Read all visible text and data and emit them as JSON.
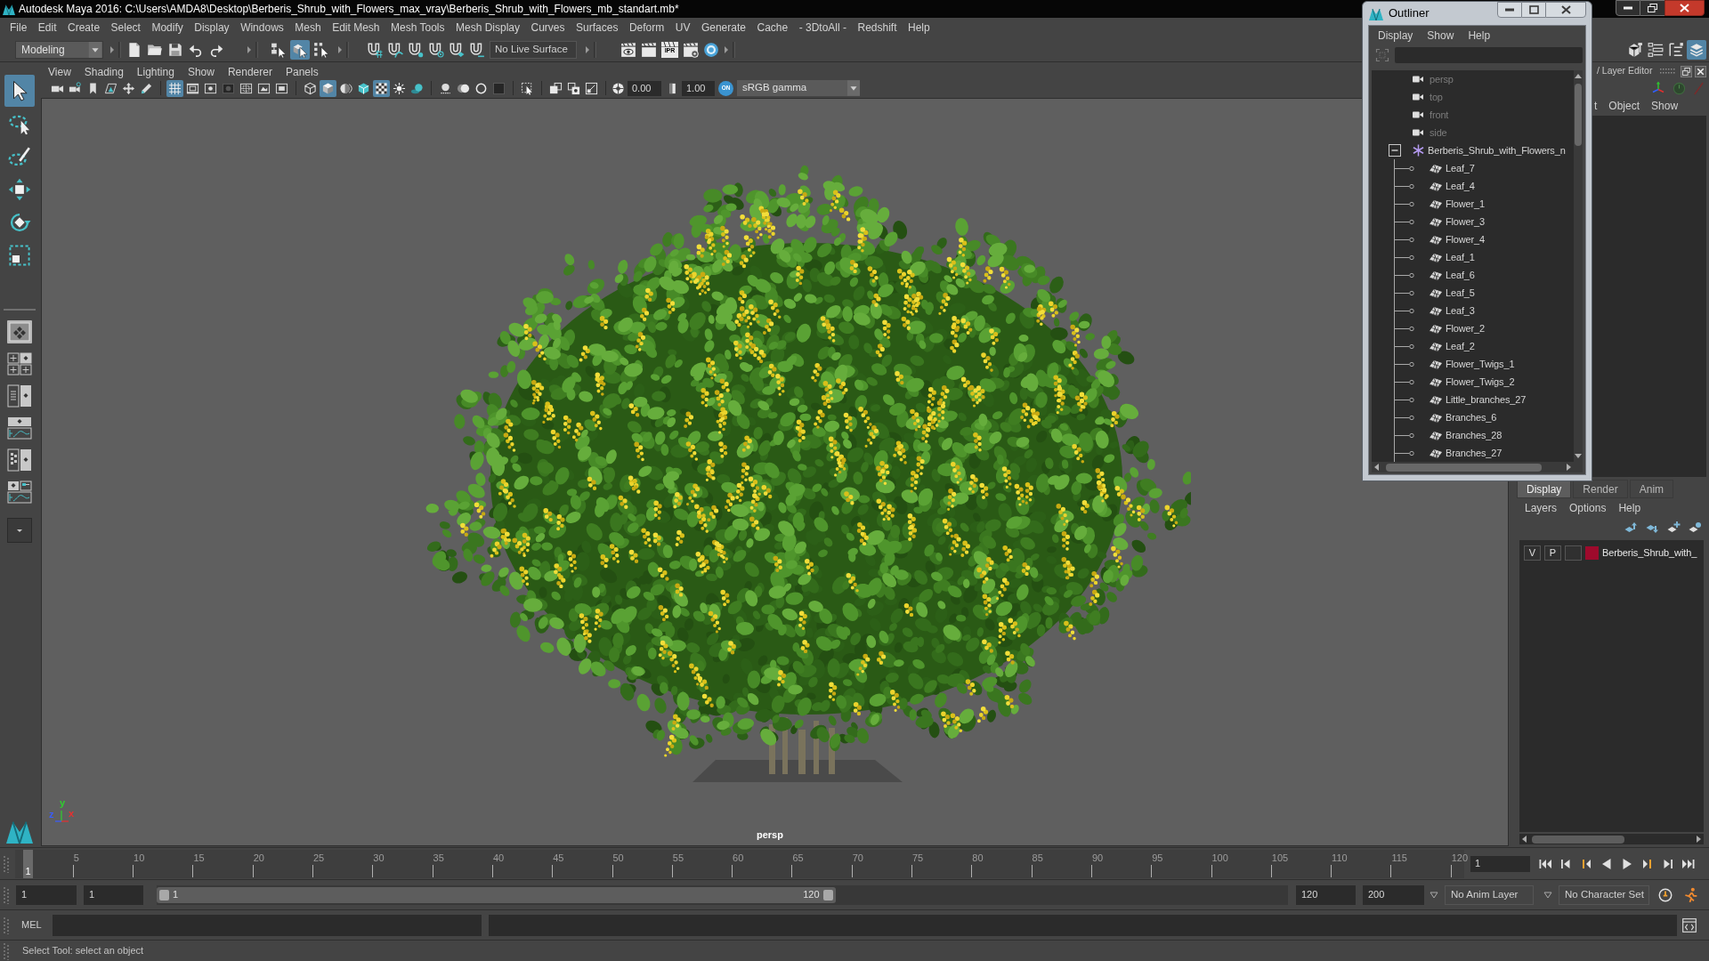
{
  "window": {
    "title": "Autodesk Maya 2016: C:\\Users\\AMDA8\\Desktop\\Berberis_Shrub_with_Flowers_max_vray\\Berberis_Shrub_with_Flowers_mb_standart.mb*"
  },
  "menubar": [
    "File",
    "Edit",
    "Create",
    "Select",
    "Modify",
    "Display",
    "Windows",
    "Mesh",
    "Edit Mesh",
    "Mesh Tools",
    "Mesh Display",
    "Curves",
    "Surfaces",
    "Deform",
    "UV",
    "Generate",
    "Cache",
    "- 3DtoAll -",
    "Redshift",
    "Help"
  ],
  "status_line": {
    "menu_set": "Modeling",
    "selection_modes": [
      {
        "selected": false
      },
      {
        "selected": true
      },
      {
        "selected": false
      }
    ],
    "live_surface": "No Live Surface",
    "ipr_label": "IPR",
    "panel_toggles": [
      {
        "selected": false
      },
      {
        "selected": false
      },
      {
        "selected": false
      },
      {
        "selected": true
      }
    ]
  },
  "toolbox": {
    "tools": [
      {
        "selected": true
      },
      {
        "selected": false
      },
      {
        "selected": false
      },
      {
        "selected": false
      },
      {
        "selected": false
      },
      {
        "selected": false
      }
    ]
  },
  "viewport": {
    "menus": [
      "View",
      "Shading",
      "Lighting",
      "Show",
      "Renderer",
      "Panels"
    ],
    "toolbar_groups": [
      [
        {
          "on": false
        },
        {
          "on": false
        },
        {
          "on": false
        },
        {
          "on": false
        },
        {
          "on": false
        },
        {
          "on": false
        }
      ],
      [
        {
          "on": true
        },
        {
          "on": false
        },
        {
          "on": false
        },
        {
          "on": false
        },
        {
          "on": false
        },
        {
          "on": false
        },
        {
          "on": false
        }
      ],
      [
        {
          "on": false
        },
        {
          "on": true
        },
        {
          "on": false
        },
        {
          "on": false
        },
        {
          "on": true
        },
        {
          "on": false
        },
        {
          "on": false
        }
      ],
      [
        {
          "on": false
        },
        {
          "on": false
        },
        {
          "on": false
        },
        {
          "on": false
        }
      ],
      [
        {
          "on": false
        }
      ],
      [
        {
          "on": false
        },
        {
          "on": false
        },
        {
          "on": false
        }
      ]
    ],
    "exposure": "0.00",
    "gamma": "1.00",
    "color_management": {
      "label": "ON",
      "on": true
    },
    "view_transform": "sRGB gamma",
    "camera": "persp",
    "axes": [
      {
        "label": "z",
        "color": "#3a5cff"
      },
      {
        "label": "y",
        "color": "#2ed12e"
      },
      {
        "label": "x",
        "color": "#e83030"
      }
    ]
  },
  "outliner": {
    "title": "Outliner",
    "menus": [
      "Display",
      "Show",
      "Help"
    ],
    "items": [
      {
        "kind": "camera",
        "label": "persp",
        "hidden": true
      },
      {
        "kind": "camera",
        "label": "top",
        "hidden": true
      },
      {
        "kind": "camera",
        "label": "front",
        "hidden": true
      },
      {
        "kind": "camera",
        "label": "side",
        "hidden": true
      },
      {
        "kind": "group",
        "label": "Berberis_Shrub_with_Flowers_n",
        "hidden": false,
        "expanded": true,
        "children": [
          {
            "kind": "mesh",
            "label": "Leaf_7",
            "hidden": false
          },
          {
            "kind": "mesh",
            "label": "Leaf_4",
            "hidden": false
          },
          {
            "kind": "mesh",
            "label": "Flower_1",
            "hidden": false
          },
          {
            "kind": "mesh",
            "label": "Flower_3",
            "hidden": false
          },
          {
            "kind": "mesh",
            "label": "Flower_4",
            "hidden": false
          },
          {
            "kind": "mesh",
            "label": "Leaf_1",
            "hidden": false
          },
          {
            "kind": "mesh",
            "label": "Leaf_6",
            "hidden": false
          },
          {
            "kind": "mesh",
            "label": "Leaf_5",
            "hidden": false
          },
          {
            "kind": "mesh",
            "label": "Leaf_3",
            "hidden": false
          },
          {
            "kind": "mesh",
            "label": "Flower_2",
            "hidden": false
          },
          {
            "kind": "mesh",
            "label": "Leaf_2",
            "hidden": false
          },
          {
            "kind": "mesh",
            "label": "Flower_Twigs_1",
            "hidden": false
          },
          {
            "kind": "mesh",
            "label": "Flower_Twigs_2",
            "hidden": false
          },
          {
            "kind": "mesh",
            "label": "Little_branches_27",
            "hidden": false
          },
          {
            "kind": "mesh",
            "label": "Branches_6",
            "hidden": false
          },
          {
            "kind": "mesh",
            "label": "Branches_28",
            "hidden": false
          },
          {
            "kind": "mesh",
            "label": "Branches_27",
            "hidden": false
          }
        ]
      }
    ]
  },
  "channel_box": {
    "title": "/ Layer Editor",
    "menus": [
      "t",
      "Object",
      "Show"
    ]
  },
  "layer_editor": {
    "tabs": [
      {
        "label": "Display",
        "selected": true
      },
      {
        "label": "Render",
        "selected": false
      },
      {
        "label": "Anim",
        "selected": false
      }
    ],
    "menus": [
      "Layers",
      "Options",
      "Help"
    ],
    "layers": [
      {
        "visibility_label": "V",
        "playback_label": "P",
        "color": "#9e0a2c",
        "name": "Berberis_Shrub_with_"
      }
    ]
  },
  "timeline": {
    "ticks": [
      "5",
      "10",
      "15",
      "20",
      "25",
      "30",
      "35",
      "40",
      "45",
      "50",
      "55",
      "60",
      "65",
      "70",
      "75",
      "80",
      "85",
      "90",
      "95",
      "100",
      "105",
      "110",
      "115",
      "120"
    ],
    "current_frame": "1",
    "level": 0,
    "frame_field": "1"
  },
  "range": {
    "start": "1",
    "playback_start": "1",
    "slider_start": "1",
    "slider_end": "120",
    "level": 0.6,
    "playback_end": "120",
    "end": "200",
    "anim_layer": "No Anim Layer",
    "character_set": "No Character Set"
  },
  "command_line": {
    "language": "MEL"
  },
  "help_line": "Select Tool: select an object"
}
